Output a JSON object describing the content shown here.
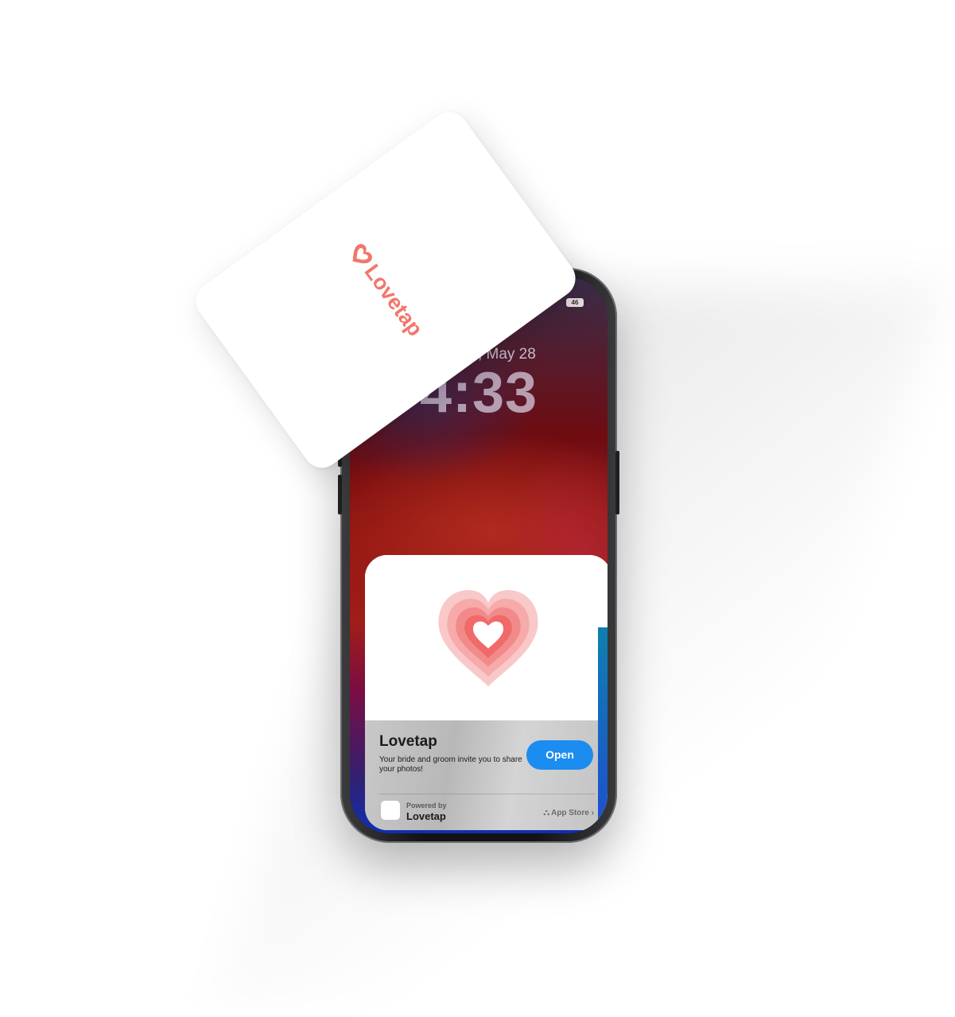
{
  "lockscreen": {
    "battery": "46",
    "date": "Tuesday, May 28",
    "time": "4:33"
  },
  "nfc_card": {
    "brand": "Lovetap",
    "logo_icon": "heart-icon",
    "brand_color": "#f2766b"
  },
  "app_clip": {
    "hero_icon": "layered-heart-icon",
    "app_name": "Lovetap",
    "description": "Your bride and groom invite you to share your photos!",
    "open_label": "Open",
    "open_color": "#1b8cf0",
    "powered_by_label": "Powered by",
    "powered_by_name": "Lovetap",
    "app_store_label": "App Store"
  }
}
